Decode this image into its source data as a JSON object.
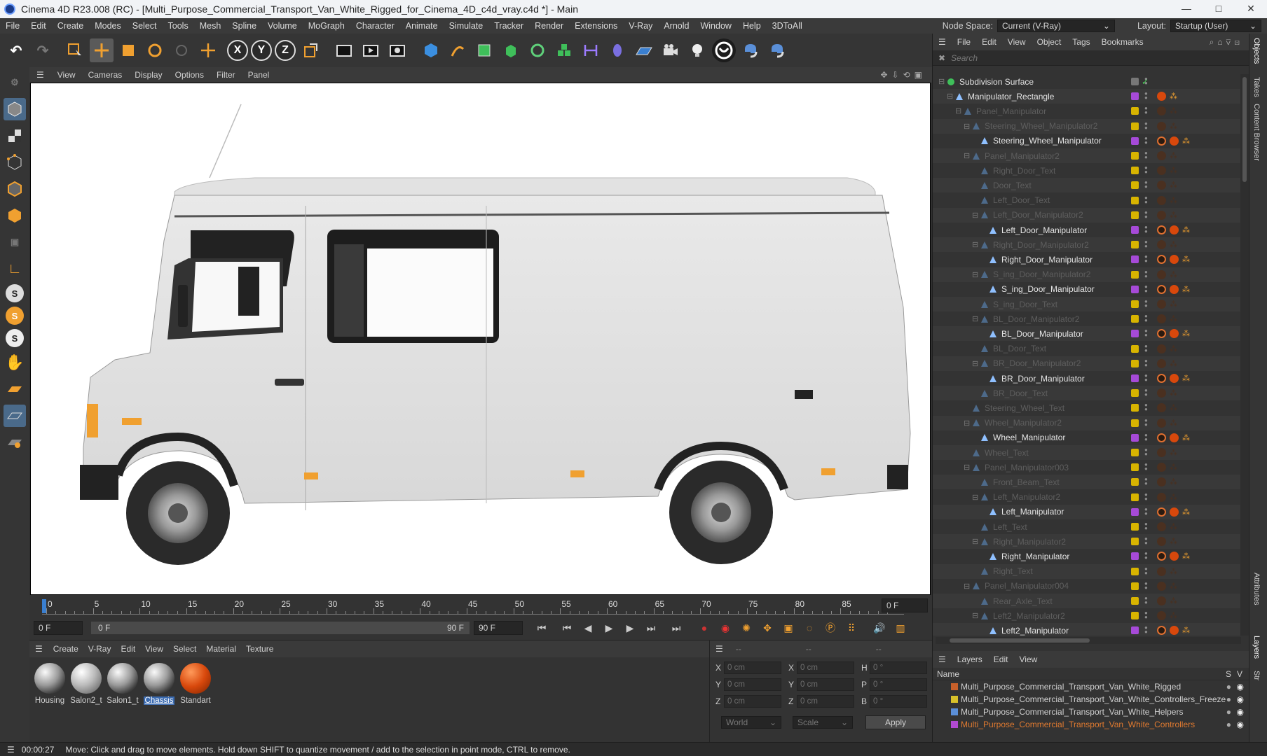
{
  "window": {
    "title": "Cinema 4D R23.008 (RC) - [Multi_Purpose_Commercial_Transport_Van_White_Rigged_for_Cinema_4D_c4d_vray.c4d *] - Main",
    "controls": [
      "—",
      "□",
      "✕"
    ]
  },
  "menubar": {
    "items": [
      "File",
      "Edit",
      "Create",
      "Modes",
      "Select",
      "Tools",
      "Mesh",
      "Spline",
      "Volume",
      "MoGraph",
      "Character",
      "Animate",
      "Simulate",
      "Tracker",
      "Render",
      "Extensions",
      "V-Ray",
      "Arnold",
      "Window",
      "Help",
      "3DToAll"
    ],
    "node_space_label": "Node Space:",
    "node_space_value": "Current (V-Ray)",
    "layout_label": "Layout:",
    "layout_value": "Startup (User)"
  },
  "toolbar": {
    "x_label": "X",
    "y_label": "Y",
    "z_label": "Z"
  },
  "viewport": {
    "menu": [
      "View",
      "Cameras",
      "Display",
      "Options",
      "Filter",
      "Panel"
    ]
  },
  "timeline": {
    "ticks": [
      "0",
      "5",
      "10",
      "15",
      "20",
      "25",
      "30",
      "35",
      "40",
      "45",
      "50",
      "55",
      "60",
      "65",
      "70",
      "75",
      "80",
      "85",
      "90"
    ],
    "current_frame": "0 F"
  },
  "playback": {
    "start": "0 F",
    "range_start": "0 F",
    "range_end": "90 F",
    "end": "90 F"
  },
  "materials": {
    "menu": [
      "Create",
      "V-Ray",
      "Edit",
      "View",
      "Select",
      "Material",
      "Texture"
    ],
    "items": [
      {
        "name": "Housing"
      },
      {
        "name": "Salon2_t"
      },
      {
        "name": "Salon1_t"
      },
      {
        "name": "Chassis"
      },
      {
        "name": "Standart"
      }
    ]
  },
  "coords": {
    "header": [
      "--",
      "--",
      "--"
    ],
    "rows": [
      {
        "a": "X",
        "av": "0 cm",
        "b": "X",
        "bv": "0 cm",
        "c": "H",
        "cv": "0 °"
      },
      {
        "a": "Y",
        "av": "0 cm",
        "b": "Y",
        "bv": "0 cm",
        "c": "P",
        "cv": "0 °"
      },
      {
        "a": "Z",
        "av": "0 cm",
        "b": "Z",
        "bv": "0 cm",
        "c": "B",
        "cv": "0 °"
      }
    ],
    "world": "World",
    "scale": "Scale",
    "apply": "Apply"
  },
  "status": {
    "time": "00:00:27",
    "message": "Move: Click and drag to move elements. Hold down SHIFT to quantize movement / add to the selection in point mode, CTRL to remove."
  },
  "objects": {
    "menu": [
      "File",
      "Edit",
      "View",
      "Object",
      "Tags",
      "Bookmarks"
    ],
    "search_placeholder": "Search",
    "rows": [
      {
        "name": "Subdivision Surface",
        "dim": false
      },
      {
        "name": "Manipulator_Rectangle",
        "dim": false
      },
      {
        "name": "Panel_Manipulator",
        "dim": true
      },
      {
        "name": "Steering_Wheel_Manipulator2",
        "dim": true
      },
      {
        "name": "Steering_Wheel_Manipulator",
        "dim": false
      },
      {
        "name": "Panel_Manipulator2",
        "dim": true
      },
      {
        "name": "Right_Door_Text",
        "dim": true
      },
      {
        "name": "Door_Text",
        "dim": true
      },
      {
        "name": "Left_Door_Text",
        "dim": true
      },
      {
        "name": "Left_Door_Manipulator2",
        "dim": true
      },
      {
        "name": "Left_Door_Manipulator",
        "dim": false
      },
      {
        "name": "Right_Door_Manipulator2",
        "dim": true
      },
      {
        "name": "Right_Door_Manipulator",
        "dim": false
      },
      {
        "name": "S_ing_Door_Manipulator2",
        "dim": true
      },
      {
        "name": "S_ing_Door_Manipulator",
        "dim": false
      },
      {
        "name": "S_ing_Door_Text",
        "dim": true
      },
      {
        "name": "BL_Door_Manipulator2",
        "dim": true
      },
      {
        "name": "BL_Door_Manipulator",
        "dim": false
      },
      {
        "name": "BL_Door_Text",
        "dim": true
      },
      {
        "name": "BR_Door_Manipulator2",
        "dim": true
      },
      {
        "name": "BR_Door_Manipulator",
        "dim": false
      },
      {
        "name": "BR_Door_Text",
        "dim": true
      },
      {
        "name": "Steering_Wheel_Text",
        "dim": true
      },
      {
        "name": "Wheel_Manipulator2",
        "dim": true
      },
      {
        "name": "Wheel_Manipulator",
        "dim": false
      },
      {
        "name": "Wheel_Text",
        "dim": true
      },
      {
        "name": "Panel_Manipulator003",
        "dim": true
      },
      {
        "name": "Front_Beam_Text",
        "dim": true
      },
      {
        "name": "Left_Manipulator2",
        "dim": true
      },
      {
        "name": "Left_Manipulator",
        "dim": false
      },
      {
        "name": "Left_Text",
        "dim": true
      },
      {
        "name": "Right_Manipulator2",
        "dim": true
      },
      {
        "name": "Right_Manipulator",
        "dim": false
      },
      {
        "name": "Right_Text",
        "dim": true
      },
      {
        "name": "Panel_Manipulator004",
        "dim": true
      },
      {
        "name": "Rear_Axle_Text",
        "dim": true
      },
      {
        "name": "Left2_Manipulator2",
        "dim": true
      },
      {
        "name": "Left2_Manipulator",
        "dim": false
      }
    ]
  },
  "layers": {
    "menu": [
      "Layers",
      "Edit",
      "View"
    ],
    "col_name": "Name",
    "col_s": "S",
    "col_v": "V",
    "rows": [
      {
        "name": "Multi_Purpose_Commercial_Transport_Van_White_Rigged",
        "color": "#c8602a"
      },
      {
        "name": "Multi_Purpose_Commercial_Transport_Van_White_Controllers_Freeze",
        "color": "#d8c12a"
      },
      {
        "name": "Multi_Purpose_Commercial_Transport_Van_White_Helpers",
        "color": "#5b8fd8"
      },
      {
        "name": "Multi_Purpose_Commercial_Transport_Van_White_Controllers",
        "color": "#b04ad0"
      }
    ]
  },
  "side_tabs": {
    "objects": "Objects",
    "takes": "Takes",
    "content": "Content Browser",
    "attributes": "Attributes",
    "layers": "Layers",
    "structure": "Str"
  }
}
